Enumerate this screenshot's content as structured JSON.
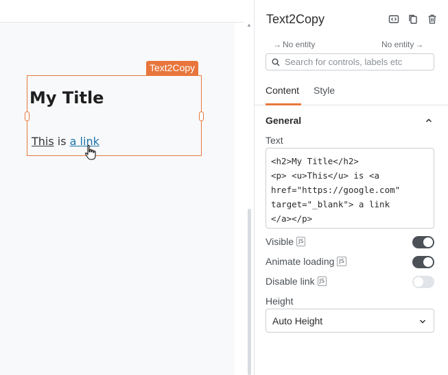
{
  "canvas": {
    "widget": {
      "tag": "Text2Copy",
      "title": "My Title",
      "para_underlined": "This",
      "para_mid": " is ",
      "para_link": " a link "
    }
  },
  "panel": {
    "title": "Text2Copy",
    "nav_left": "No entity",
    "nav_right": "No entity",
    "search_placeholder": "Search for controls, labels etc",
    "tabs": [
      {
        "label": "Content",
        "active": true
      },
      {
        "label": "Style",
        "active": false
      }
    ],
    "section": "General",
    "text_label": "Text",
    "text_value": "<h2>My Title</h2>\n<p> <u>This</u> is <a\nhref=\"https://google.com\"\ntarget=\"_blank\"> a link\n</a></p>",
    "toggles": [
      {
        "label": "Visible",
        "js": "JS",
        "on": true
      },
      {
        "label": "Animate loading",
        "js": "JS",
        "on": true
      },
      {
        "label": "Disable link",
        "js": "JS",
        "on": false
      }
    ],
    "height_label": "Height",
    "height_value": "Auto Height"
  },
  "colors": {
    "accent": "#e8763c",
    "toggle_on": "#4b5157",
    "link": "#1a73a8"
  },
  "icons": [
    "code-icon",
    "copy-icon",
    "trash-icon",
    "arrow-right-icon",
    "search-icon",
    "chevron-up-icon",
    "chevron-down-icon",
    "hand-cursor-icon"
  ]
}
